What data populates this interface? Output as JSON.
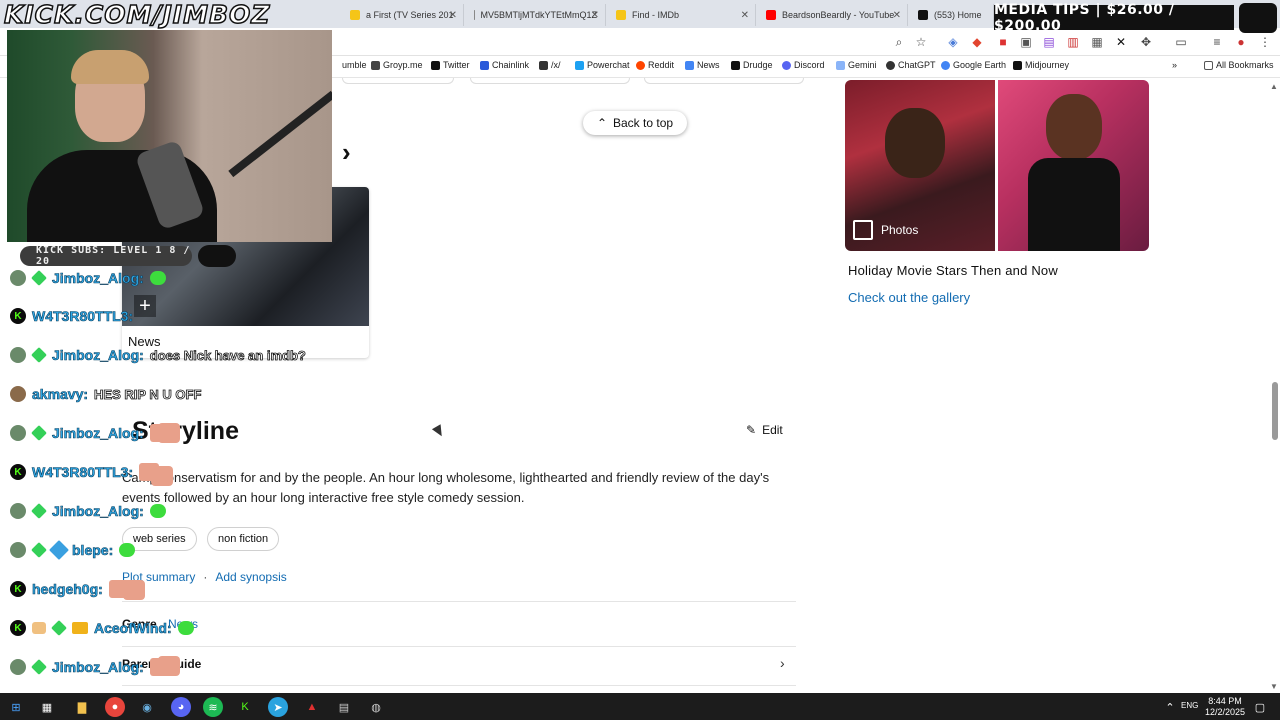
{
  "stream": {
    "kick_url": "KICK.COM/JIMBOZ",
    "media_tips": "MEDIA TIPS | $26.00 / $200.00",
    "subs_bar": "KICK SUBS: LEVEL 1 8 / 20"
  },
  "browser": {
    "tabs": [
      {
        "label": "a First (TV Series 201",
        "color": "#f5c518"
      },
      {
        "label": "MV5BMTljMTdkYTEtMmQ1Z",
        "color": "#888888"
      },
      {
        "label": "Find - IMDb",
        "color": "#f5c518"
      },
      {
        "label": "BeardsonBeardly - YouTube",
        "color": "#ff0000"
      },
      {
        "label": "(553) Home",
        "color": "#111111"
      }
    ],
    "bookmarks": [
      {
        "label": "umble",
        "color": "#85c742"
      },
      {
        "label": "Groyp.me",
        "color": "#444444"
      },
      {
        "label": "Twitter",
        "color": "#111111"
      },
      {
        "label": "Chainlink",
        "color": "#2a5ada"
      },
      {
        "label": "/x/",
        "color": "#333333"
      },
      {
        "label": "Powerchat",
        "color": "#1da1f2"
      },
      {
        "label": "Reddit",
        "color": "#ff4500"
      },
      {
        "label": "News",
        "color": "#4285f4"
      },
      {
        "label": "Drudge",
        "color": "#111111"
      },
      {
        "label": "Discord",
        "color": "#5865f2"
      },
      {
        "label": "Gemini",
        "color": "#8ab4f8"
      },
      {
        "label": "ChatGPT",
        "color": "#333333"
      },
      {
        "label": "Google Earth",
        "color": "#4285f4"
      },
      {
        "label": "Midjourney",
        "color": "#111111"
      }
    ],
    "all_bookmarks": "All Bookmarks"
  },
  "page": {
    "back_to_top": "Back to top",
    "news_label": "News",
    "gallery_photos": "Photos",
    "gallery_title": "Holiday Movie Stars Then and Now",
    "gallery_link": "Check out the gallery",
    "storyline_title": "Storyline",
    "edit_label": "Edit",
    "plot_text": "Camp conservatism for and by the people. An hour long wholesome, lighthearted and friendly review of the day's events followed by an hour long interactive free style comedy session.",
    "chips": [
      "web series",
      "non fiction"
    ],
    "plot_summary_link": "Plot summary",
    "add_synopsis_link": "Add synopsis",
    "genre_label": "Genre",
    "genre_value": "News",
    "parents_guide": "Parents guide"
  },
  "chat": [
    {
      "user": "Jimboz_Alog:",
      "msg": "",
      "badges": [
        "av",
        "diamond"
      ],
      "emote": "green"
    },
    {
      "user": "W4T3R80TTL3:",
      "msg": "",
      "badges": [
        "k"
      ],
      "emote": ""
    },
    {
      "user": "Jimboz_Alog:",
      "msg": "does Nick have an imdb?",
      "badges": [
        "av",
        "diamond"
      ],
      "emote": ""
    },
    {
      "user": "akmavy:",
      "msg": "HES RIP N U OFF",
      "badges": [
        "av2"
      ],
      "emote": ""
    },
    {
      "user": "Jimboz_Alog:",
      "msg": "",
      "badges": [
        "av",
        "diamond"
      ],
      "emote": "face"
    },
    {
      "user": "W4T3R80TTL3:",
      "msg": "",
      "badges": [
        "k"
      ],
      "emote": "face"
    },
    {
      "user": "Jimboz_Alog:",
      "msg": "",
      "badges": [
        "av",
        "diamond"
      ],
      "emote": "green"
    },
    {
      "user": "blepe:",
      "msg": "",
      "badges": [
        "av",
        "diamond",
        "sword"
      ],
      "emote": "green"
    },
    {
      "user": "hedgeh0g:",
      "msg": "",
      "badges": [
        "k"
      ],
      "emote": "face"
    },
    {
      "user": "AceofWind:",
      "msg": "",
      "badges": [
        "k",
        "bread",
        "diamond",
        "crown"
      ],
      "emote": "green"
    },
    {
      "user": "Jimboz_Alog:",
      "msg": "",
      "badges": [
        "av",
        "diamond"
      ],
      "emote": "face"
    }
  ],
  "taskbar": {
    "language": "ENG",
    "time": "8:44 PM",
    "date": "12/2/2025"
  }
}
